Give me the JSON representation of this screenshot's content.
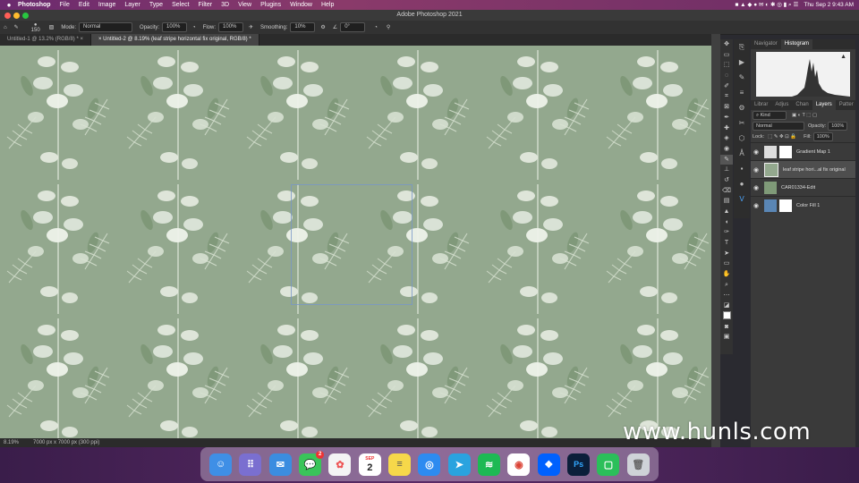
{
  "menubar": {
    "app": "Photoshop",
    "items": [
      "File",
      "Edit",
      "Image",
      "Layer",
      "Type",
      "Select",
      "Filter",
      "3D",
      "View",
      "Plugins",
      "Window",
      "Help"
    ],
    "clock": "Thu Sep 2  9:43 AM"
  },
  "window": {
    "title": "Adobe Photoshop 2021"
  },
  "options": {
    "brush_size": "150",
    "mode_label": "Mode:",
    "mode_value": "Normal",
    "opacity_label": "Opacity:",
    "opacity_value": "100%",
    "flow_label": "Flow:",
    "flow_value": "100%",
    "smoothing_label": "Smoothing:",
    "smoothing_value": "10%",
    "angle_value": "0°"
  },
  "tabs": [
    {
      "label": "Untitled-1 @ 13.2% (RGB/8) *"
    },
    {
      "label": "Untitled-2 @ 8.19% (leaf stripe horizontal fix original, RGB/8) *"
    }
  ],
  "status": {
    "zoom": "8.19%",
    "doc_size": "7000 px x 7000 px (300 ppi)"
  },
  "panel_top": {
    "tabs": [
      "Navigator",
      "Histogram"
    ]
  },
  "panel_layers": {
    "tabs": [
      "Librar",
      "Adjus",
      "Chan",
      "Layers",
      "Patter"
    ],
    "kind": "Kind",
    "blend": "Normal",
    "opacity_label": "Opacity:",
    "opacity_value": "100%",
    "lock_label": "Lock:",
    "fill_label": "Fill:",
    "fill_value": "100%",
    "layers": [
      {
        "name": "Gradient Map 1"
      },
      {
        "name": "leaf stripe hori...al fix original"
      },
      {
        "name": "CAR01334-Edit"
      },
      {
        "name": "Color Fill 1"
      }
    ]
  },
  "watermark": "www.hunls.com",
  "dock": {
    "calendar_month": "SEP",
    "calendar_day": "2",
    "messages_badge": "2"
  },
  "colors": {
    "canvas_bg": "#93a88e",
    "leaf": "#e7ede2",
    "dark_leaf": "#6e8a66"
  }
}
